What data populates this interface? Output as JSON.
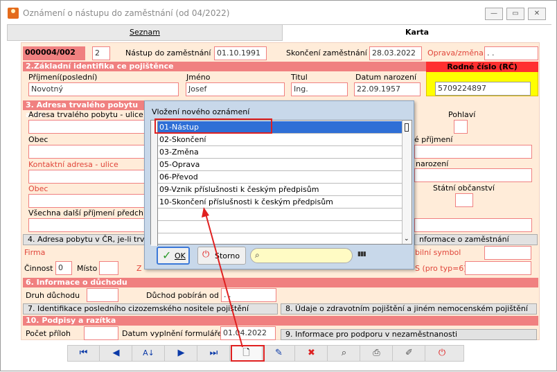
{
  "window": {
    "title": "Oznámení o nástupu do zaměstnání (od 04/2022)"
  },
  "tabs": [
    "Seznam",
    "Karta"
  ],
  "header": {
    "id": "000004/002",
    "num": "2",
    "nastup_label": "Nástup do zaměstnání",
    "nastup": "01.10.1991",
    "skonceni_label": "Skončení zaměstnání",
    "skonceni": "28.03.2022",
    "oprava_label": "Oprava/změna",
    "oprava": ". ."
  },
  "sec2": {
    "title": "2.Základní identifika ce pojištěnce",
    "prijmeni_l": "Příjmení(poslední)",
    "prijmeni": "Novotný",
    "jmeno_l": "Jméno",
    "jmeno": "Josef",
    "titul_l": "Titul",
    "titul": "Ing.",
    "datum_l": "Datum narození",
    "datum": "22.09.1957",
    "rc_l": "Rodné číslo (RČ)",
    "rc": "5709224897"
  },
  "sec3": {
    "title": "3. Adresa trvalého pobytu a do",
    "adresa_l": "Adresa trvalého pobytu - ulice",
    "pohlavi_l": "Pohlaví",
    "obec_l": "Obec",
    "prijmeni2_l": "é příjmení",
    "kontakt_l": "Kontaktní adresa - ulice",
    "narozeni_l": "narození",
    "obec2_l": "Obec",
    "statni_l": "Státní občanství",
    "dalsi_l": "Všechna další příjmení předch"
  },
  "sec4": {
    "btn": "4. Adresa pobytu v ČR, je-li trva",
    "info_btn": "nformace o zaměstnání",
    "firma_l": "Firma",
    "symbol_l": "bilní symbol",
    "cinnost_l": "Činnost",
    "cinnost": "0",
    "misto_l": "Místo",
    "z_l": "Z",
    "typ_l": "S (pro typ=6)"
  },
  "sec6": {
    "title": "6. Informace o důchodu",
    "druh_l": "Druh důchodu",
    "pobiran_l": "Důchod pobírán od",
    "pobiran": ". ."
  },
  "buttons": {
    "b7": "7. Identifikace posledního cizozemského nositele pojištění",
    "b8": "8. Údaje o zdravotním pojištění a jiném nemocenském pojištění",
    "b9": "9. Informace pro podporu v nezaměstnanosti"
  },
  "sec10": {
    "title": "10. Podpisy a razítka",
    "pocet_l": "Počet příloh",
    "vyplneni_l": "Datum vyplnění formuláře",
    "vyplneni": "01.04.2022"
  },
  "dialog": {
    "title": "Vložení nového oznámení",
    "items": [
      "01-Nástup",
      "02-Skončení",
      "03-Změna",
      "05-Oprava",
      "06-Převod",
      "09-Vznik příslušnosti k českým předpisům",
      "10-Skončení příslušnosti k českým předpisům"
    ],
    "ok": "OK",
    "storno": "Storno"
  },
  "colors": {
    "section": "#f08080",
    "form_bg": "#ffecd9",
    "selection": "#2f6fd6",
    "annotation": "#e02020"
  },
  "toolbar": [
    "first-icon",
    "prev-icon",
    "sort-icon",
    "next-icon",
    "last-icon",
    "new-document-icon",
    "edit-icon",
    "delete-icon",
    "find-icon",
    "print-icon",
    "pen-icon",
    "power-icon"
  ]
}
